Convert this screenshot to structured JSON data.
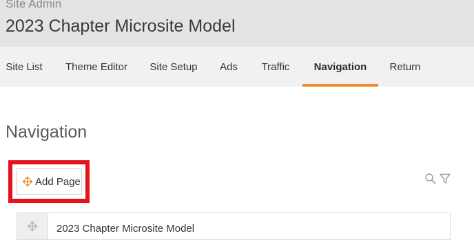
{
  "header": {
    "subtitle": "Site Admin",
    "title": "2023 Chapter Microsite Model"
  },
  "tabs": [
    {
      "label": "Site List",
      "active": false
    },
    {
      "label": "Theme Editor",
      "active": false
    },
    {
      "label": "Site Setup",
      "active": false
    },
    {
      "label": "Ads",
      "active": false
    },
    {
      "label": "Traffic",
      "active": false
    },
    {
      "label": "Navigation",
      "active": true
    },
    {
      "label": "Return",
      "active": false
    }
  ],
  "section": {
    "title": "Navigation"
  },
  "toolbar": {
    "add_page_label": "Add Page",
    "add_page_icon": "move-arrows-icon",
    "search_icon": "search-icon",
    "filter_icon": "filter-icon"
  },
  "pages": [
    {
      "label": "2023 Chapter Microsite Model",
      "handle_icon": "drag-handle-icon"
    }
  ],
  "colors": {
    "header_bg": "#e4e4e4",
    "tabs_bg": "#f1f1f1",
    "accent": "#ee8a2e",
    "highlight": "#e3141c"
  }
}
